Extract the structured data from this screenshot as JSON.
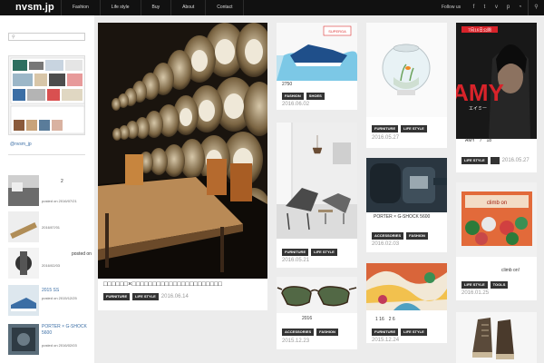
{
  "header": {
    "logo": "nvsm.jp",
    "nav": [
      "Fashion",
      "Life style",
      "Buy",
      "About",
      "Contact"
    ],
    "follow_label": "Follow us",
    "social_icons": [
      "facebook-icon",
      "twitter-icon",
      "vimeo-icon",
      "pinterest-icon",
      "rss-icon"
    ],
    "search_icon": "search-icon"
  },
  "sidebar": {
    "search_placeholder": "",
    "instagram_handle": "@nvsm_jp",
    "recent_posts": [
      {
        "title": "2",
        "date": "posted on 2016/07/21"
      },
      {
        "title": "",
        "date": "2016/07/01"
      },
      {
        "title": "posted on",
        "date": "2016/02/03"
      },
      {
        "title": "2015 SS",
        "date": "posted on 2015/12/25"
      },
      {
        "title": "PORTER × G-SHOCK 5600",
        "date": "posted on 2016/02/03"
      }
    ]
  },
  "posts": [
    {
      "id": "whisky",
      "title": "□□□□□□×□□□□□□□□□□□□□□□□□□□□□□",
      "tags": [
        "FURNITURE",
        "LIFE STYLE"
      ],
      "date": "2016.06.14"
    },
    {
      "id": "superga",
      "title": "2750",
      "tags": [
        "FASHION",
        "SHOES"
      ],
      "date": "2016.06.02"
    },
    {
      "id": "chair",
      "title": "",
      "tags": [
        "FURNITURE",
        "LIFE STYLE"
      ],
      "date": "2016.05.21"
    },
    {
      "id": "glasses",
      "title": "2016",
      "tags": [
        "ACCESSORIES",
        "FASHION"
      ],
      "date": "2015.12.23"
    },
    {
      "id": "aquarium",
      "title": "",
      "tags": [
        "FURNITURE",
        "LIFE STYLE"
      ],
      "date": "2016.05.27"
    },
    {
      "id": "gshock",
      "title": "PORTER × G-SHOCK 5600",
      "tags": [
        "ACCESSORIES",
        "FASHION"
      ],
      "date": "2016.02.03"
    },
    {
      "id": "textile",
      "title": "1 16　2 6",
      "tags": [
        "FURNITURE",
        "LIFE STYLE"
      ],
      "date": "2015.12.24"
    },
    {
      "id": "amy",
      "title": "AMY　7　18",
      "tags": [
        "LIFE STYLE",
        ""
      ],
      "date": "2016.05.27"
    },
    {
      "id": "climb",
      "title": "climb on!",
      "tags": [
        "LIFE STYLE",
        "TOOLS"
      ],
      "date": "2016.01.25"
    },
    {
      "id": "boots",
      "title": "",
      "tags": [],
      "date": ""
    }
  ],
  "amy_poster": {
    "title": "AMY",
    "subtitle": "エイミー",
    "top_text": "7月16日公開"
  },
  "superga_logo": "SUPERGA",
  "climb_logo": "climb on"
}
